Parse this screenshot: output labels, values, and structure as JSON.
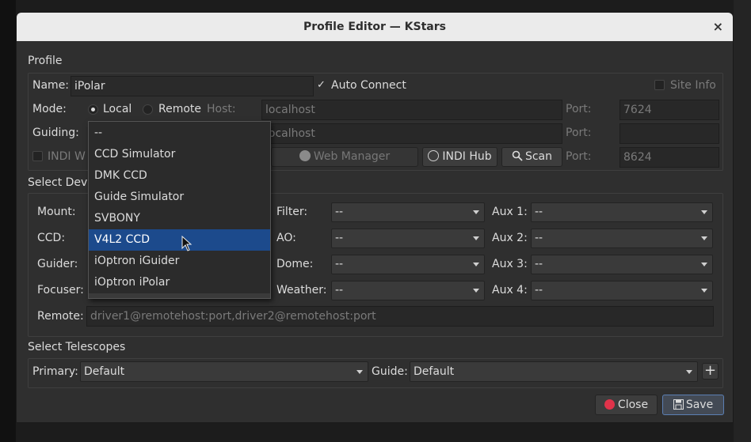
{
  "window": {
    "title": "Profile Editor — KStars",
    "close_symbol": "×"
  },
  "profile": {
    "section_title": "Profile",
    "name_label": "Name:",
    "name_value": "iPolar",
    "auto_connect_label": "Auto Connect",
    "auto_connect_checked": true,
    "site_info_label": "Site Info",
    "site_info_checked": false,
    "mode_label": "Mode:",
    "mode_local": "Local",
    "mode_remote": "Remote",
    "mode_selected": "Local",
    "host_label": "Host:",
    "host_value": "localhost",
    "port_label": "Port:",
    "port_value": "7624",
    "guiding_label": "Guiding:",
    "guiding_host_value": "localhost",
    "guiding_port_label": "Port:",
    "guiding_port_value": "",
    "indi_web_label": "INDI W",
    "web_manager_label": "Web Manager",
    "indi_hub_label": "INDI Hub",
    "scan_label": "Scan",
    "web_port_label": "Port:",
    "web_port_value": "8624"
  },
  "devices": {
    "section_title": "Select Devi",
    "mount_label": "Mount:",
    "ccd_label": "CCD:",
    "guider_label": "Guider:",
    "focuser_label": "Focuser:",
    "filter_label": "Filter:",
    "ao_label": "AO:",
    "dome_label": "Dome:",
    "weather_label": "Weather:",
    "filter_value": "--",
    "ao_value": "--",
    "dome_value": "--",
    "weather_value": "--",
    "aux1_label": "Aux 1:",
    "aux2_label": "Aux 2:",
    "aux3_label": "Aux 3:",
    "aux4_label": "Aux 4:",
    "aux1_value": "--",
    "aux2_value": "--",
    "aux3_value": "--",
    "aux4_value": "--",
    "remote_label": "Remote:",
    "remote_placeholder": "driver1@remotehost:port,driver2@remotehost:port"
  },
  "dropdown": {
    "items": [
      "--",
      "CCD Simulator",
      "DMK CCD",
      "Guide Simulator",
      "SVBONY",
      "V4L2 CCD",
      "iOptron iGuider",
      "iOptron iPolar"
    ],
    "selected_index": 5
  },
  "telescopes": {
    "section_title": "Select Telescopes",
    "primary_label": "Primary:",
    "primary_value": "Default",
    "guide_label": "Guide:",
    "guide_value": "Default",
    "add_symbol": "+"
  },
  "footer": {
    "close_label": "Close",
    "save_label": "Save"
  },
  "colors": {
    "selection": "#1c4a8c",
    "dialog_bg": "#2f2f2f",
    "close_icon": "#e0334a"
  }
}
